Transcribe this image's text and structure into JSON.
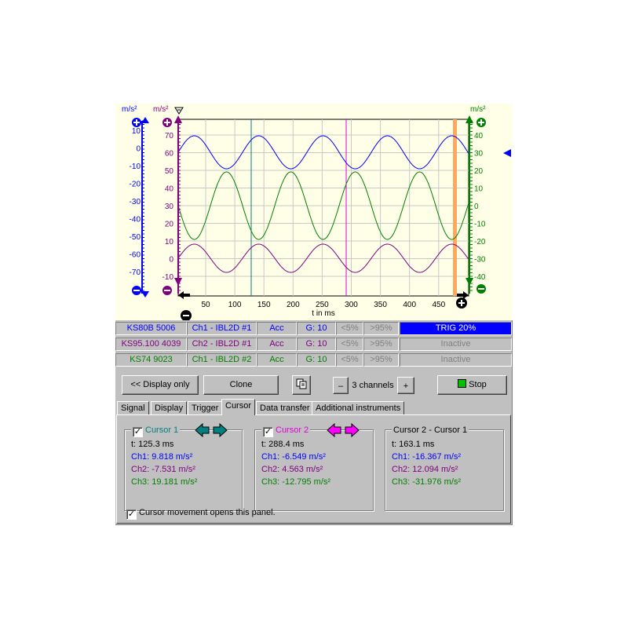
{
  "scope": {
    "left_axis_unit": "m/s²",
    "mid_axis_unit": "m/s²",
    "right_axis_unit": "m/s²",
    "x_axis_label": "t in ms",
    "left_ticks": [
      "10",
      "0",
      "-10",
      "-20",
      "-30",
      "-40",
      "-50",
      "-60",
      "-70"
    ],
    "mid_ticks": [
      "70",
      "60",
      "50",
      "40",
      "30",
      "20",
      "10",
      "0",
      "-10"
    ],
    "right_ticks": [
      "40",
      "30",
      "20",
      "10",
      "0",
      "-10",
      "-20",
      "-30",
      "-40"
    ],
    "x_ticks": [
      "50",
      "100",
      "150",
      "200",
      "250",
      "300",
      "350",
      "400",
      "450"
    ],
    "colors": {
      "ch1": "#0000ff",
      "ch2": "#800080",
      "ch3": "#008000",
      "cursor1": "#008080",
      "cursor2": "#e000e0",
      "trigger": "#ffa860"
    }
  },
  "channels": [
    {
      "sensor": "KS80B 5006",
      "input": "Ch1 - IBL2D #1",
      "mode": "Acc",
      "gain": "G: 10",
      "lo": "<5%",
      "hi": ">95%",
      "status": "TRIG   20%",
      "color": "#0000ff",
      "active": true
    },
    {
      "sensor": "KS95.100 4039",
      "input": "Ch2 - IBL2D #1",
      "mode": "Acc",
      "gain": "G: 10",
      "lo": "<5%",
      "hi": ">95%",
      "status": "Inactive",
      "color": "#800080",
      "active": false
    },
    {
      "sensor": "KS74 9023",
      "input": "Ch1 - IBL2D #2",
      "mode": "Acc",
      "gain": "G: 10",
      "lo": "<5%",
      "hi": ">95%",
      "status": "Inactive",
      "color": "#008000",
      "active": false
    }
  ],
  "buttons": {
    "display_only": "<< Display only",
    "clone": "Clone",
    "minus": "–",
    "channels": "3 channels",
    "plus": "+",
    "stop": "Stop"
  },
  "tabs": [
    "Signal",
    "Display",
    "Trigger",
    "Cursor",
    "Data transfer",
    "Additional instruments"
  ],
  "cursor": {
    "c1": {
      "title": "Cursor 1",
      "t": "t: 125.3 ms",
      "ch1": "Ch1: 9.818 m/s²",
      "ch2": "Ch2: -7.531 m/s²",
      "ch3": "Ch3: 19.181 m/s²"
    },
    "c2": {
      "title": "Cursor 2",
      "t": "t: 288.4 ms",
      "ch1": "Ch1: -6.549 m/s²",
      "ch2": "Ch2: 4.563 m/s²",
      "ch3": "Ch3: -12.795 m/s²"
    },
    "diff": {
      "title": "Cursor 2 - Cursor 1",
      "t": "t: 163.1 ms",
      "ch1": "Ch1: -16.367 m/s²",
      "ch2": "Ch2: 12.094 m/s²",
      "ch3": "Ch3: -31.976 m/s²"
    },
    "open_panel_label": "Cursor movement opens this panel."
  }
}
